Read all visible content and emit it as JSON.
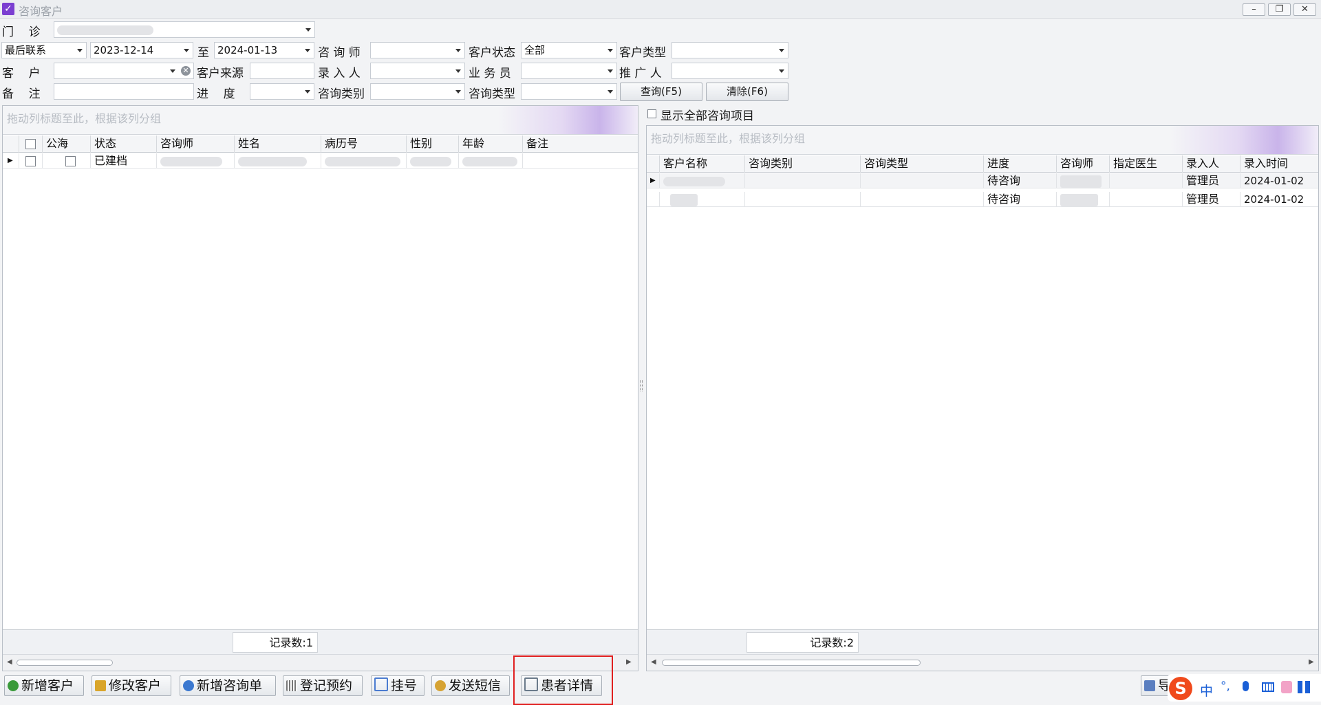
{
  "window": {
    "title": "咨询客户",
    "btn_min": "–",
    "btn_restore": "❐",
    "btn_close": "✕"
  },
  "filters": {
    "clinic_label": "门    诊",
    "date_type": "最后联系",
    "date_from": "2023-12-14",
    "to_label": "至",
    "date_to": "2024-01-13",
    "consultant_label": "咨 询 师",
    "status_label": "客户状态",
    "status_value": "全部",
    "type_label": "客户类型",
    "customer_label": "客    户",
    "source_label": "客户来源",
    "entry_label": "录 入 人",
    "salesman_label": "业 务 员",
    "promoter_label": "推 广 人",
    "remark_label": "备    注",
    "progress_label": "进    度",
    "cat_label": "咨询类别",
    "ctype_label": "咨询类型",
    "query_btn": "查询(F5)",
    "clear_btn": "清除(F6)"
  },
  "left_grid": {
    "group_hint": "拖动列标题至此，根据该列分组",
    "columns": [
      "公海",
      "状态",
      "咨询师",
      "姓名",
      "病历号",
      "性别",
      "年龄",
      "备注"
    ],
    "rows": [
      {
        "status": "已建档"
      }
    ],
    "count": "记录数:1"
  },
  "right_grid": {
    "show_all_label": "显示全部咨询项目",
    "group_hint": "拖动列标题至此，根据该列分组",
    "columns": [
      "客户名称",
      "咨询类别",
      "咨询类型",
      "进度",
      "咨询师",
      "指定医生",
      "录入人",
      "录入时间"
    ],
    "rows": [
      {
        "progress": "待咨询",
        "entry_by": "管理员",
        "entry_time": "2024-01-02"
      },
      {
        "progress": "待咨询",
        "entry_by": "管理员",
        "entry_time": "2024-01-02"
      }
    ],
    "count": "记录数:2"
  },
  "toolbar": {
    "add_customer": "新增客户",
    "edit_customer": "修改客户",
    "add_consult": "新增咨询单",
    "register_appt": "登记预约",
    "register_no": "挂号",
    "send_sms": "发送短信",
    "patient_detail": "患者详情",
    "export_partial": "导"
  },
  "ime": {
    "logo": "S",
    "lang": "中",
    "punct": "°,",
    "items": [
      "mic-icon",
      "keyboard-icon",
      "skin-icon",
      "grid-icon"
    ]
  },
  "colors": {
    "highlight_box": "#e01f1f",
    "accent": "#7b3fd1"
  }
}
